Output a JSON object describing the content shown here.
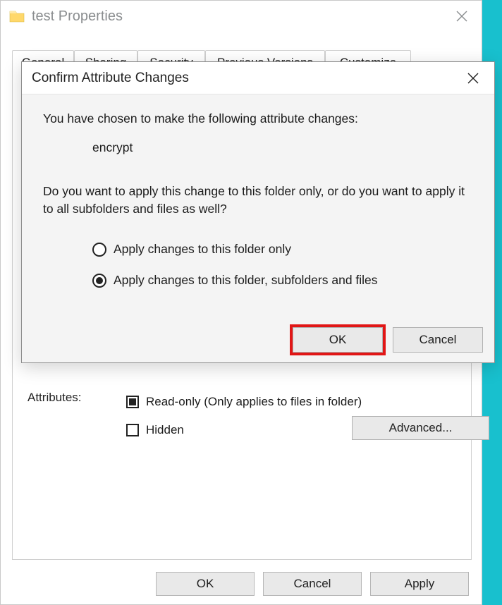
{
  "properties": {
    "title": "test Properties",
    "tabs": [
      "General",
      "Sharing",
      "Security",
      "Previous Versions",
      "Customize"
    ],
    "attributes": {
      "label": "Attributes:",
      "readonly_label": "Read-only (Only applies to files in folder)",
      "readonly_state": "mixed",
      "hidden_label": "Hidden",
      "hidden_state": "unchecked",
      "advanced_btn": "Advanced..."
    },
    "footer": {
      "ok": "OK",
      "cancel": "Cancel",
      "apply": "Apply"
    }
  },
  "confirm_dialog": {
    "title": "Confirm Attribute Changes",
    "intro": "You have chosen to make the following attribute changes:",
    "attribute": "encrypt",
    "question": "Do you want to apply this change to this folder only, or do you want to apply it to all subfolders and files as well?",
    "options": {
      "folder_only": "Apply changes to this folder only",
      "recursive": "Apply changes to this folder, subfolders and files"
    },
    "selected": "recursive",
    "buttons": {
      "ok": "OK",
      "cancel": "Cancel"
    }
  }
}
